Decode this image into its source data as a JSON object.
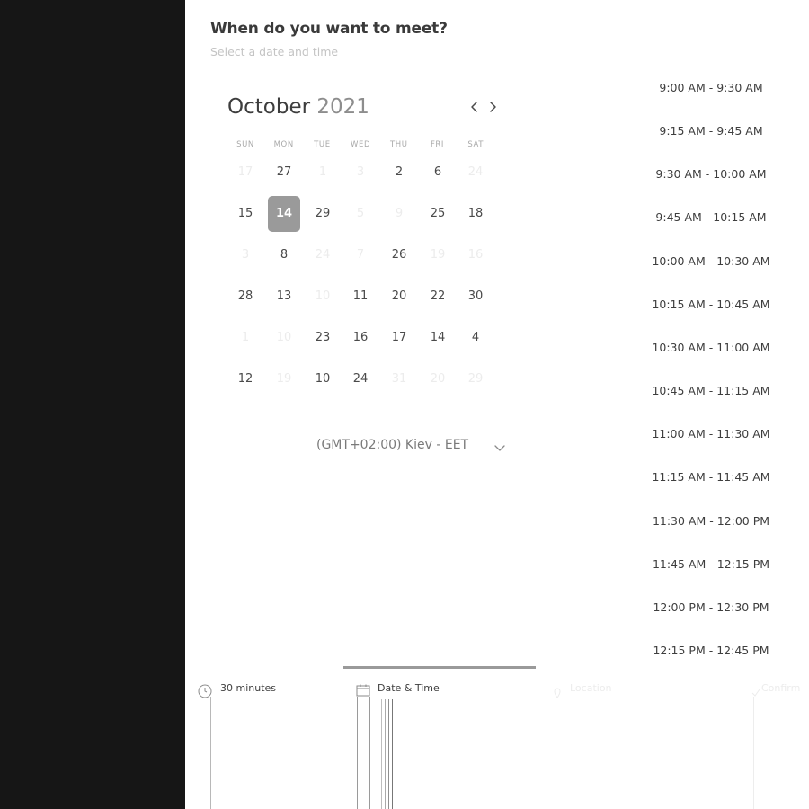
{
  "header": {
    "title": "When do you want to meet?",
    "subtitle": "Select a date and time"
  },
  "calendar": {
    "month": "October",
    "year": "2021",
    "weekdays": [
      "SUN",
      "MON",
      "TUE",
      "WED",
      "THU",
      "FRI",
      "SAT"
    ],
    "weeks": [
      [
        {
          "day": "17",
          "faded": true
        },
        {
          "day": "27",
          "faded": false
        },
        {
          "day": "1",
          "faded": true
        },
        {
          "day": "3",
          "faded": true
        },
        {
          "day": "2",
          "faded": false
        },
        {
          "day": "6",
          "faded": false
        },
        {
          "day": "24",
          "faded": true
        }
      ],
      [
        {
          "day": "15",
          "faded": false
        },
        {
          "day": "14",
          "faded": false,
          "selected": true
        },
        {
          "day": "29",
          "faded": false
        },
        {
          "day": "5",
          "faded": true
        },
        {
          "day": "9",
          "faded": true
        },
        {
          "day": "25",
          "faded": false
        },
        {
          "day": "18",
          "faded": false
        }
      ],
      [
        {
          "day": "3",
          "faded": true
        },
        {
          "day": "8",
          "faded": false
        },
        {
          "day": "24",
          "faded": true
        },
        {
          "day": "7",
          "faded": true
        },
        {
          "day": "26",
          "faded": false
        },
        {
          "day": "19",
          "faded": true
        },
        {
          "day": "16",
          "faded": true
        }
      ],
      [
        {
          "day": "28",
          "faded": false
        },
        {
          "day": "13",
          "faded": false
        },
        {
          "day": "10",
          "faded": true
        },
        {
          "day": "11",
          "faded": false
        },
        {
          "day": "20",
          "faded": false
        },
        {
          "day": "22",
          "faded": false
        },
        {
          "day": "30",
          "faded": false
        }
      ],
      [
        {
          "day": "1",
          "faded": true
        },
        {
          "day": "10",
          "faded": true
        },
        {
          "day": "23",
          "faded": false
        },
        {
          "day": "16",
          "faded": false
        },
        {
          "day": "17",
          "faded": false
        },
        {
          "day": "14",
          "faded": false
        },
        {
          "day": "4",
          "faded": false
        }
      ],
      [
        {
          "day": "12",
          "faded": false
        },
        {
          "day": "19",
          "faded": true
        },
        {
          "day": "10",
          "faded": false
        },
        {
          "day": "24",
          "faded": false
        },
        {
          "day": "31",
          "faded": true
        },
        {
          "day": "20",
          "faded": true
        },
        {
          "day": "29",
          "faded": true
        }
      ]
    ],
    "selected_day": "14"
  },
  "timezone": {
    "label": "(GMT+02:00) Kiev - EET",
    "icon": "chevron-down-icon"
  },
  "time_slots": [
    "9:00 AM - 9:30 AM",
    "9:15 AM - 9:45 AM",
    "9:30 AM - 10:00 AM",
    "9:45 AM - 10:15 AM",
    "10:00 AM - 10:30 AM",
    "10:15 AM - 10:45 AM",
    "10:30 AM - 11:00 AM",
    "10:45 AM - 11:15 AM",
    "11:00 AM - 11:30 AM",
    "11:15 AM - 11:45 AM",
    "11:30 AM - 12:00 PM",
    "11:45 AM - 12:15 PM",
    "12:00 PM - 12:30 PM",
    "12:15 PM - 12:45 PM"
  ],
  "steps": [
    {
      "label": "30 minutes",
      "icon": "clock-icon",
      "active": true
    },
    {
      "label": "Date & Time",
      "icon": "calendar-icon",
      "active": true
    },
    {
      "label": "Location",
      "icon": "location-icon",
      "active": false
    },
    {
      "label": "Confirm",
      "icon": "check-icon",
      "active": false
    }
  ],
  "colors": {
    "sidebar": "#161616",
    "selected": "#9a9a9a",
    "text": "#3e3e3e",
    "muted": "#c4c4c4"
  }
}
